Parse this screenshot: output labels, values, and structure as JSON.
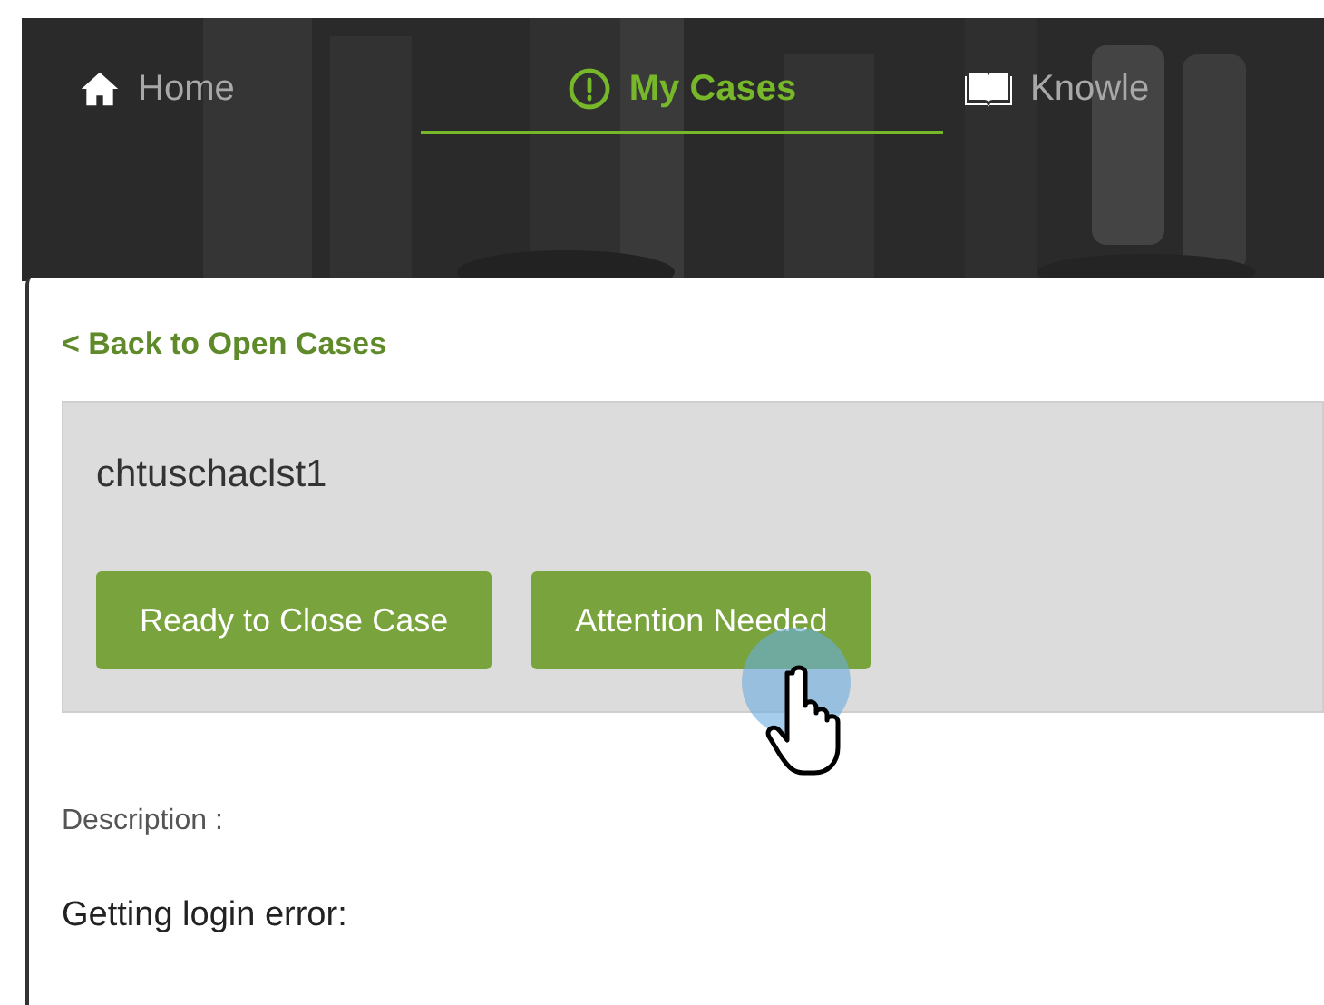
{
  "nav": [
    {
      "label": "Home",
      "selected": false
    },
    {
      "label": "My Cases",
      "selected": true
    },
    {
      "label": "Knowle",
      "selected": false
    }
  ],
  "back_link": "< Back to Open Cases",
  "case": {
    "title": "chtuschaclst1",
    "buttons": [
      "Ready to Close Case",
      "Attention Needed"
    ]
  },
  "description": {
    "label": "Description :",
    "text": "Getting login error:"
  }
}
